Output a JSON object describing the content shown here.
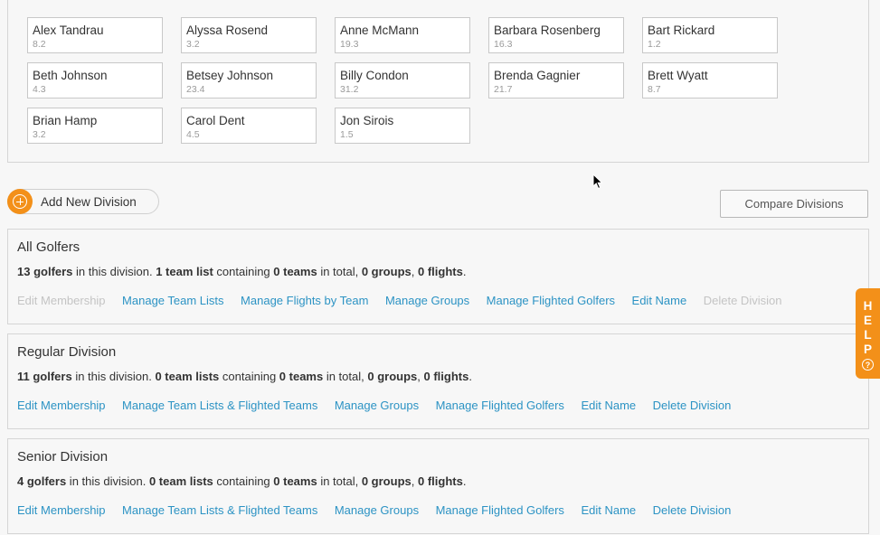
{
  "golfers": [
    {
      "name": "Alex Tandrau",
      "handicap": "8.2"
    },
    {
      "name": "Alyssa Rosend",
      "handicap": "3.2"
    },
    {
      "name": "Anne McMann",
      "handicap": "19.3"
    },
    {
      "name": "Barbara Rosenberg",
      "handicap": "16.3"
    },
    {
      "name": "Bart Rickard",
      "handicap": "1.2"
    },
    {
      "name": "Beth Johnson",
      "handicap": "4.3"
    },
    {
      "name": "Betsey Johnson",
      "handicap": "23.4"
    },
    {
      "name": "Billy Condon",
      "handicap": "31.2"
    },
    {
      "name": "Brenda Gagnier",
      "handicap": "21.7"
    },
    {
      "name": "Brett Wyatt",
      "handicap": "8.7"
    },
    {
      "name": "Brian Hamp",
      "handicap": "3.2"
    },
    {
      "name": "Carol Dent",
      "handicap": "4.5"
    },
    {
      "name": "Jon Sirois",
      "handicap": "1.5"
    }
  ],
  "toolbar": {
    "add_division_label": "Add New Division",
    "compare_label": "Compare Divisions"
  },
  "divisions": [
    {
      "name": "All Golfers",
      "summary": {
        "golfers": "13 golfers",
        "t1": " in this division. ",
        "team_lists": "1 team list",
        "t2": " containing ",
        "teams": "0 teams",
        "t3": " in total, ",
        "groups": "0 groups",
        "t4": ", ",
        "flights": "0 flights",
        "t5": "."
      },
      "actions": [
        {
          "label": "Edit Membership",
          "enabled": false
        },
        {
          "label": "Manage Team Lists",
          "enabled": true
        },
        {
          "label": "Manage Flights by Team",
          "enabled": true
        },
        {
          "label": "Manage Groups",
          "enabled": true
        },
        {
          "label": "Manage Flighted Golfers",
          "enabled": true
        },
        {
          "label": "Edit Name",
          "enabled": true
        },
        {
          "label": "Delete Division",
          "enabled": false
        }
      ]
    },
    {
      "name": "Regular Division",
      "summary": {
        "golfers": "11 golfers",
        "t1": " in this division. ",
        "team_lists": "0 team lists",
        "t2": " containing ",
        "teams": "0 teams",
        "t3": " in total, ",
        "groups": "0 groups",
        "t4": ", ",
        "flights": "0 flights",
        "t5": "."
      },
      "actions": [
        {
          "label": "Edit Membership",
          "enabled": true
        },
        {
          "label": "Manage Team Lists & Flighted Teams",
          "enabled": true
        },
        {
          "label": "Manage Groups",
          "enabled": true
        },
        {
          "label": "Manage Flighted Golfers",
          "enabled": true
        },
        {
          "label": "Edit Name",
          "enabled": true
        },
        {
          "label": "Delete Division",
          "enabled": true
        }
      ]
    },
    {
      "name": "Senior Division",
      "summary": {
        "golfers": "4 golfers",
        "t1": " in this division. ",
        "team_lists": "0 team lists",
        "t2": " containing ",
        "teams": "0 teams",
        "t3": " in total, ",
        "groups": "0 groups",
        "t4": ", ",
        "flights": "0 flights",
        "t5": "."
      },
      "actions": [
        {
          "label": "Edit Membership",
          "enabled": true
        },
        {
          "label": "Manage Team Lists & Flighted Teams",
          "enabled": true
        },
        {
          "label": "Manage Groups",
          "enabled": true
        },
        {
          "label": "Manage Flighted Golfers",
          "enabled": true
        },
        {
          "label": "Edit Name",
          "enabled": true
        },
        {
          "label": "Delete Division",
          "enabled": true
        }
      ]
    }
  ],
  "help": {
    "letters": [
      "H",
      "E",
      "L",
      "P"
    ],
    "question_mark": "?"
  },
  "colors": {
    "accent": "#f39019",
    "link": "#2c93c4",
    "disabled_link": "#c4c4c4"
  }
}
